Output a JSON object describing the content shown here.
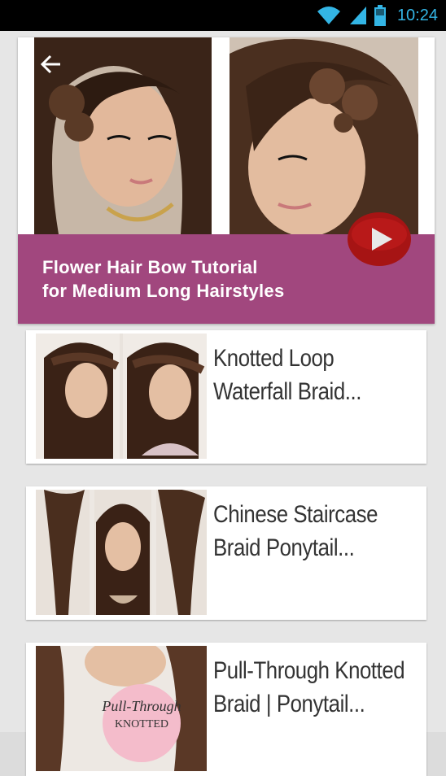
{
  "status_bar": {
    "time": "10:24",
    "icons": [
      "wifi-icon",
      "signal-icon",
      "battery-icon"
    ],
    "accent_color": "#33b5e5"
  },
  "hero": {
    "title": "Flower Hair Bow Tutorial\nfor Medium Long Hairstyles",
    "title_bar_color": "#a1477e",
    "back_icon": "back-arrow-icon",
    "play_icon": "play-icon"
  },
  "videos": [
    {
      "title": "Knotted Loop\nWaterfall Braid..."
    },
    {
      "title": "Chinese Staircase\nBraid Ponytail..."
    },
    {
      "title": "Pull-Through Knotted\nBraid | Ponytail...",
      "thumb_text_1": "Pull-Through",
      "thumb_text_2": "KNOTTED"
    }
  ]
}
